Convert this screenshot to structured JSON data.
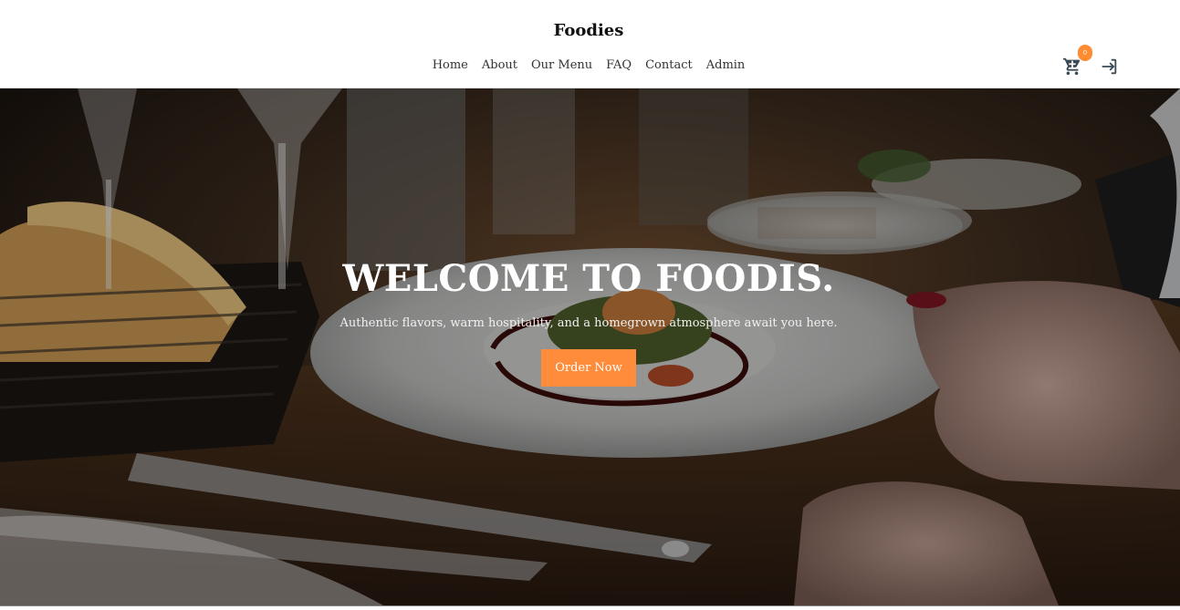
{
  "header": {
    "brand": "Foodies",
    "nav": [
      "Home",
      "About",
      "Our Menu",
      "FAQ",
      "Contact",
      "Admin"
    ],
    "cart_count": "0",
    "icons": {
      "cart": "cart-icon",
      "login": "login-icon"
    }
  },
  "hero": {
    "title": "WELCOME TO FOODIS.",
    "subtitle": "Authentic flavors, warm hospitality, and a homegrown atmosphere await you here.",
    "cta_label": "Order Now"
  },
  "colors": {
    "accent": "#ff8c3a",
    "header_bg": "#ffffff",
    "text_dark": "#111111"
  }
}
